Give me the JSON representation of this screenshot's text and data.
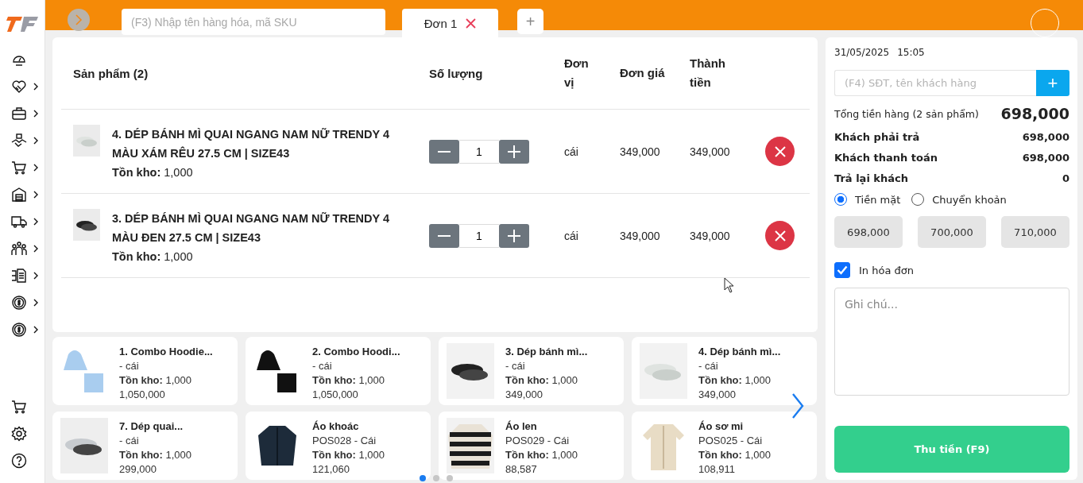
{
  "header": {
    "search": {
      "placeholder": "(F3) Nhập tên hàng hóa, mã SKU"
    },
    "tabs": [
      {
        "label": "Đơn 1",
        "selected": true
      }
    ],
    "add_tab": "+"
  },
  "sidebar": {
    "items": [
      {
        "has_submenu": false
      },
      {
        "has_submenu": true
      },
      {
        "has_submenu": true
      },
      {
        "has_submenu": true
      },
      {
        "has_submenu": true
      },
      {
        "has_submenu": true
      },
      {
        "has_submenu": true
      },
      {
        "has_submenu": true
      },
      {
        "has_submenu": true
      },
      {
        "has_submenu": true
      },
      {
        "has_submenu": true
      }
    ]
  },
  "cart": {
    "columns": [
      "Sản phẩm (2)",
      "Số lượng",
      "Đơn vị",
      "Đơn giá",
      "Thành tiền"
    ],
    "rows": [
      {
        "name": "4. DÉP BÁNH MÌ QUAI NGANG NAM NỮ TRENDY 4 MÀU XÁM RÊU 27.5 CM | SIZE43",
        "stock": "**Tồn kho:** 1,000",
        "quantity": "1",
        "unit": "cái",
        "price": "349,000",
        "total": "349,000"
      },
      {
        "name": "3. DÉP BÁNH MÌ QUAI NGANG NAM NỮ TRENDY 4 MÀU ĐEN 27.5 CM | SIZE43",
        "stock": "**Tồn kho:** 1,000",
        "quantity": "1",
        "unit": "cái",
        "price": "349,000",
        "total": "349,000"
      }
    ]
  },
  "products": [
    {
      "name": "1. Combo Hoodie...",
      "sub": " - cái",
      "stock": "**Tồn kho:** 1,000",
      "price": "1,050,000"
    },
    {
      "name": "2. Combo Hoodi...",
      "sub": " - cái",
      "stock": "**Tồn kho:** 1,000",
      "price": "1,050,000"
    },
    {
      "name": "3. Dép bánh mì...",
      "sub": " - cái",
      "stock": "**Tồn kho:** 1,000",
      "price": "349,000"
    },
    {
      "name": "4. Dép bánh mì...",
      "sub": " - cái",
      "stock": "**Tồn kho:** 1,000",
      "price": "349,000"
    },
    {
      "name": "7. Dép quai...",
      "sub": " - cái",
      "stock": "**Tồn kho:** 1,000",
      "price": "299,000"
    },
    {
      "name": "Áo khoác",
      "sub": "POS028 - Cái",
      "stock": "**Tồn kho:** 1,000",
      "price": "121,060"
    },
    {
      "name": "Áo len",
      "sub": "POS029 - Cái",
      "stock": "**Tồn kho:** 1,000",
      "price": "88,587"
    },
    {
      "name": "Áo sơ mi",
      "sub": "POS025 - Cái",
      "stock": "**Tồn kho:** 1,000",
      "price": "108,911"
    }
  ],
  "pages": [
    {
      "selected": true
    },
    {
      "selected": false
    },
    {
      "selected": false
    }
  ],
  "checkout": {
    "date": "31/05/2025",
    "time": "15:05",
    "customer": {
      "placeholder": "(F4) SĐT, tên khách hàng"
    },
    "add_customer": "+",
    "subtotal_label": "Tổng tiền hàng (2 sản phẩm)",
    "subtotal": "698,000",
    "summary": [
      {
        "label": "Khách phải trả",
        "value": "698,000"
      },
      {
        "label": "Khách thanh toán",
        "value": "698,000"
      },
      {
        "label": "Trả lại khách",
        "value": "0"
      }
    ],
    "payment_methods": [
      {
        "label": "Tiền mặt",
        "selected": true
      },
      {
        "label": "Chuyển khoản",
        "selected": false
      }
    ],
    "quick_amounts": [
      "698,000",
      "700,000",
      "710,000"
    ],
    "print_invoice": {
      "label": "In hóa đơn",
      "checked": true
    },
    "note": {
      "placeholder": "Ghi chú..."
    },
    "pay_button": "Thu tiền (F9)"
  }
}
